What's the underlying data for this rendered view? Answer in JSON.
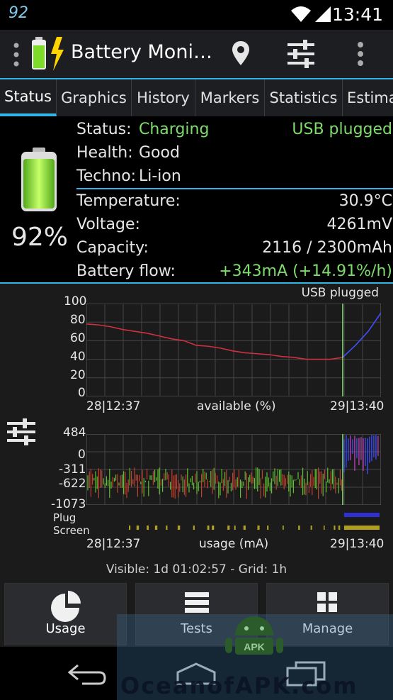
{
  "statusbar": {
    "left_glyph": "92",
    "time": "13:41"
  },
  "actionbar": {
    "title": "Battery Moni…"
  },
  "tabs": [
    {
      "label": "Status",
      "active": true
    },
    {
      "label": "Graphics"
    },
    {
      "label": "History"
    },
    {
      "label": "Markers"
    },
    {
      "label": "Statistics"
    },
    {
      "label": "Estima"
    }
  ],
  "battery": {
    "percent": "92%",
    "level": 0.92,
    "status_label": "Status:",
    "status_value": "Charging",
    "plug_value": "USB plugged",
    "health_label": "Health:",
    "health_value": "Good",
    "techno_label": "Techno:",
    "techno_value": "Li-ion",
    "temperature_label": "Temperature:",
    "temperature_value": "30.9°C",
    "voltage_label": "Voltage:",
    "voltage_value": "4261mV",
    "capacity_label": "Capacity:",
    "capacity_value": "2116 / 2300mAh",
    "flow_label": "Battery flow:",
    "flow_value": "+343mA (+14.91%/h)"
  },
  "graph1": {
    "plug_label": "USB plugged",
    "y_ticks": [
      "100",
      "80",
      "60",
      "40",
      "20",
      "0"
    ],
    "x_start": "28|12:37",
    "x_label": "available (%)",
    "x_end": "29|13:40"
  },
  "graph2": {
    "y_ticks": [
      "484",
      "0",
      "-311",
      "-622",
      "-1073"
    ],
    "row_plug": "Plug",
    "row_screen": "Screen",
    "x_start": "28|12:37",
    "x_label": "usage (mA)",
    "x_end": "29|13:40"
  },
  "visible_text": "Visible: 1d 01:02:57 - Grid: 1h",
  "buttons": {
    "usage": "Usage",
    "tests": "Tests",
    "manage": "Manage"
  },
  "watermark": {
    "text": "OceanofAPK.com",
    "logo": "APK"
  },
  "colors": {
    "accent": "#33b5e5",
    "green": "#7ddc6a",
    "line_red": "#d03040",
    "line_blue": "#4050ff",
    "plug_bar": "#3030d0",
    "screen_bar": "#b0a020"
  },
  "chart_data": [
    {
      "type": "line",
      "title": "",
      "xlabel": "available (%)",
      "ylabel": "",
      "x": [
        "28|12:37",
        "29|13:40"
      ],
      "ylim": [
        0,
        100
      ],
      "series": [
        {
          "values": [
            78,
            77,
            75,
            72,
            70,
            68,
            65,
            62,
            60,
            55,
            54,
            52,
            49,
            47,
            46,
            45,
            43,
            42,
            40,
            40,
            40,
            42,
            55,
            70,
            90
          ]
        }
      ]
    },
    {
      "type": "line",
      "title": "",
      "xlabel": "usage (mA)",
      "ylabel": "",
      "x": [
        "28|12:37",
        "29|13:40"
      ],
      "ylim": [
        -1073,
        484
      ]
    }
  ]
}
